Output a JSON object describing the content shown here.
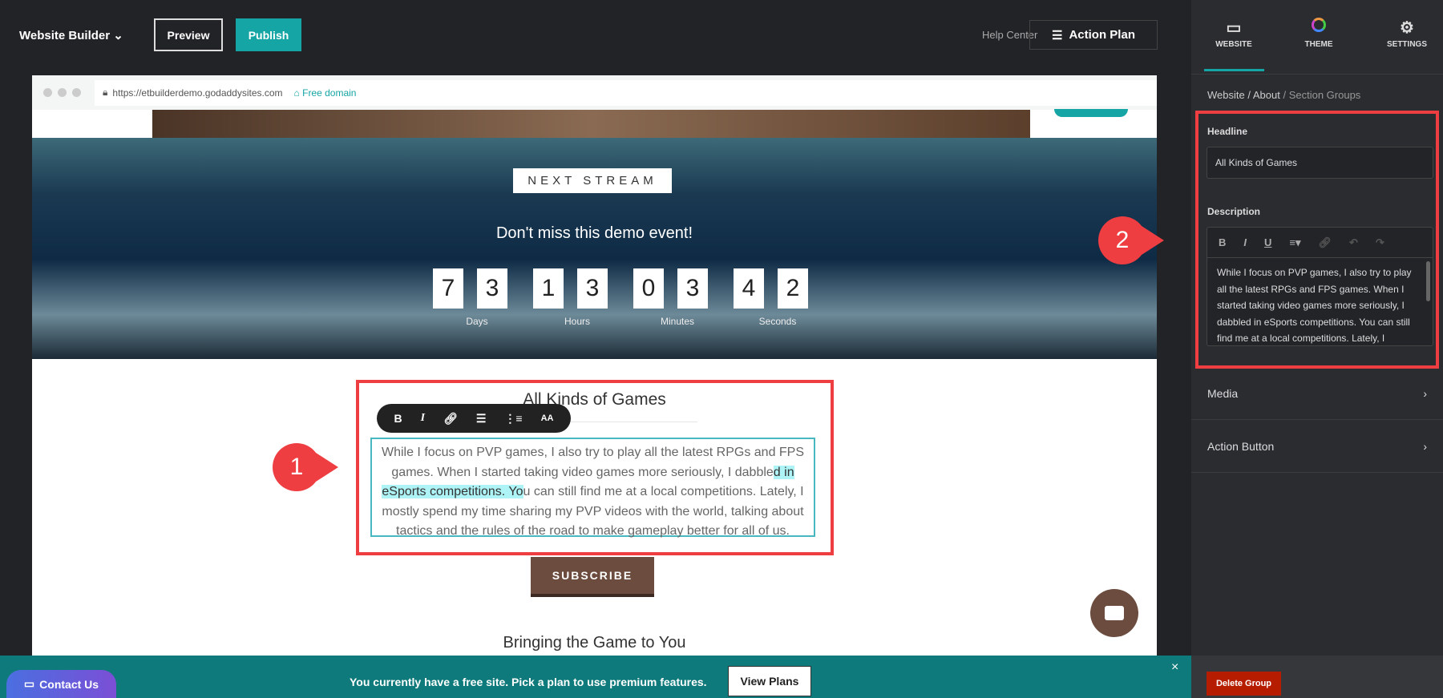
{
  "topbar": {
    "title": "Website Builder",
    "preview": "Preview",
    "publish": "Publish",
    "help": "Help Center",
    "action_plan": "Action Plan"
  },
  "browser": {
    "url": "https://etbuilderdemo.godaddysites.com",
    "domain": "Free domain"
  },
  "hero": {
    "badge": "NEXT STREAM",
    "subtitle": "Don't miss this demo event!",
    "digits": [
      "7",
      "3",
      "1",
      "3",
      "0",
      "3",
      "4",
      "2"
    ],
    "labels": [
      "Days",
      "Hours",
      "Minutes",
      "Seconds"
    ]
  },
  "section": {
    "headline": "All Kinds of Games",
    "text_before": "While I focus on PVP games, I also try to play all the latest RPGs and FPS games. When I started taking video games more seriously, I dabble",
    "text_highlight": "d in eSports competitions. Yo",
    "text_after": "u can still find me at a local competitions. Lately, I mostly spend my time sharing my PVP videos with the world, talking about tactics and the rules of the road to make gameplay better for all of us.",
    "toolbar": [
      "B",
      "I",
      "link",
      "bullets",
      "numbers",
      "font-size"
    ],
    "toolbar_aa": "AA",
    "subscribe": "SUBSCRIBE",
    "next_headline": "Bringing the Game to You"
  },
  "banner": {
    "contact": "Contact Us",
    "message": "You currently have a free site. Pick a plan to use premium features.",
    "view_plans": "View Plans",
    "close": "×"
  },
  "panel": {
    "tabs": [
      {
        "label": "WEBSITE",
        "active": true
      },
      {
        "label": "THEME"
      },
      {
        "label": "SETTINGS"
      }
    ],
    "breadcrumb": [
      "Website",
      "/ About",
      "/ Section Groups"
    ],
    "headline_label": "Headline",
    "headline_value": "All Kinds of Games",
    "description_label": "Description",
    "description_tools": [
      "B",
      "I",
      "U",
      "≡▾",
      "link",
      "undo",
      "redo"
    ],
    "description_value": "While I focus on PVP games, I also try to play all the latest RPGs and FPS games. When I started taking video games more seriously, I dabbled in eSports competitions. You can still find me at a local competitions. Lately, I mostly spend my time sharing my PVP videos with the world, talking about tactics and the rules of the road to make gameplay better for all of us.",
    "rows": [
      "Media",
      "Action Button"
    ],
    "delete": "Delete Group"
  },
  "annotations": [
    "1",
    "2"
  ],
  "colors": {
    "accent": "#16a5a5",
    "annotation": "#ef3e42",
    "subscribe": "#6b4c3e",
    "banner": "#0f7a7b",
    "delete": "#b51c00"
  }
}
